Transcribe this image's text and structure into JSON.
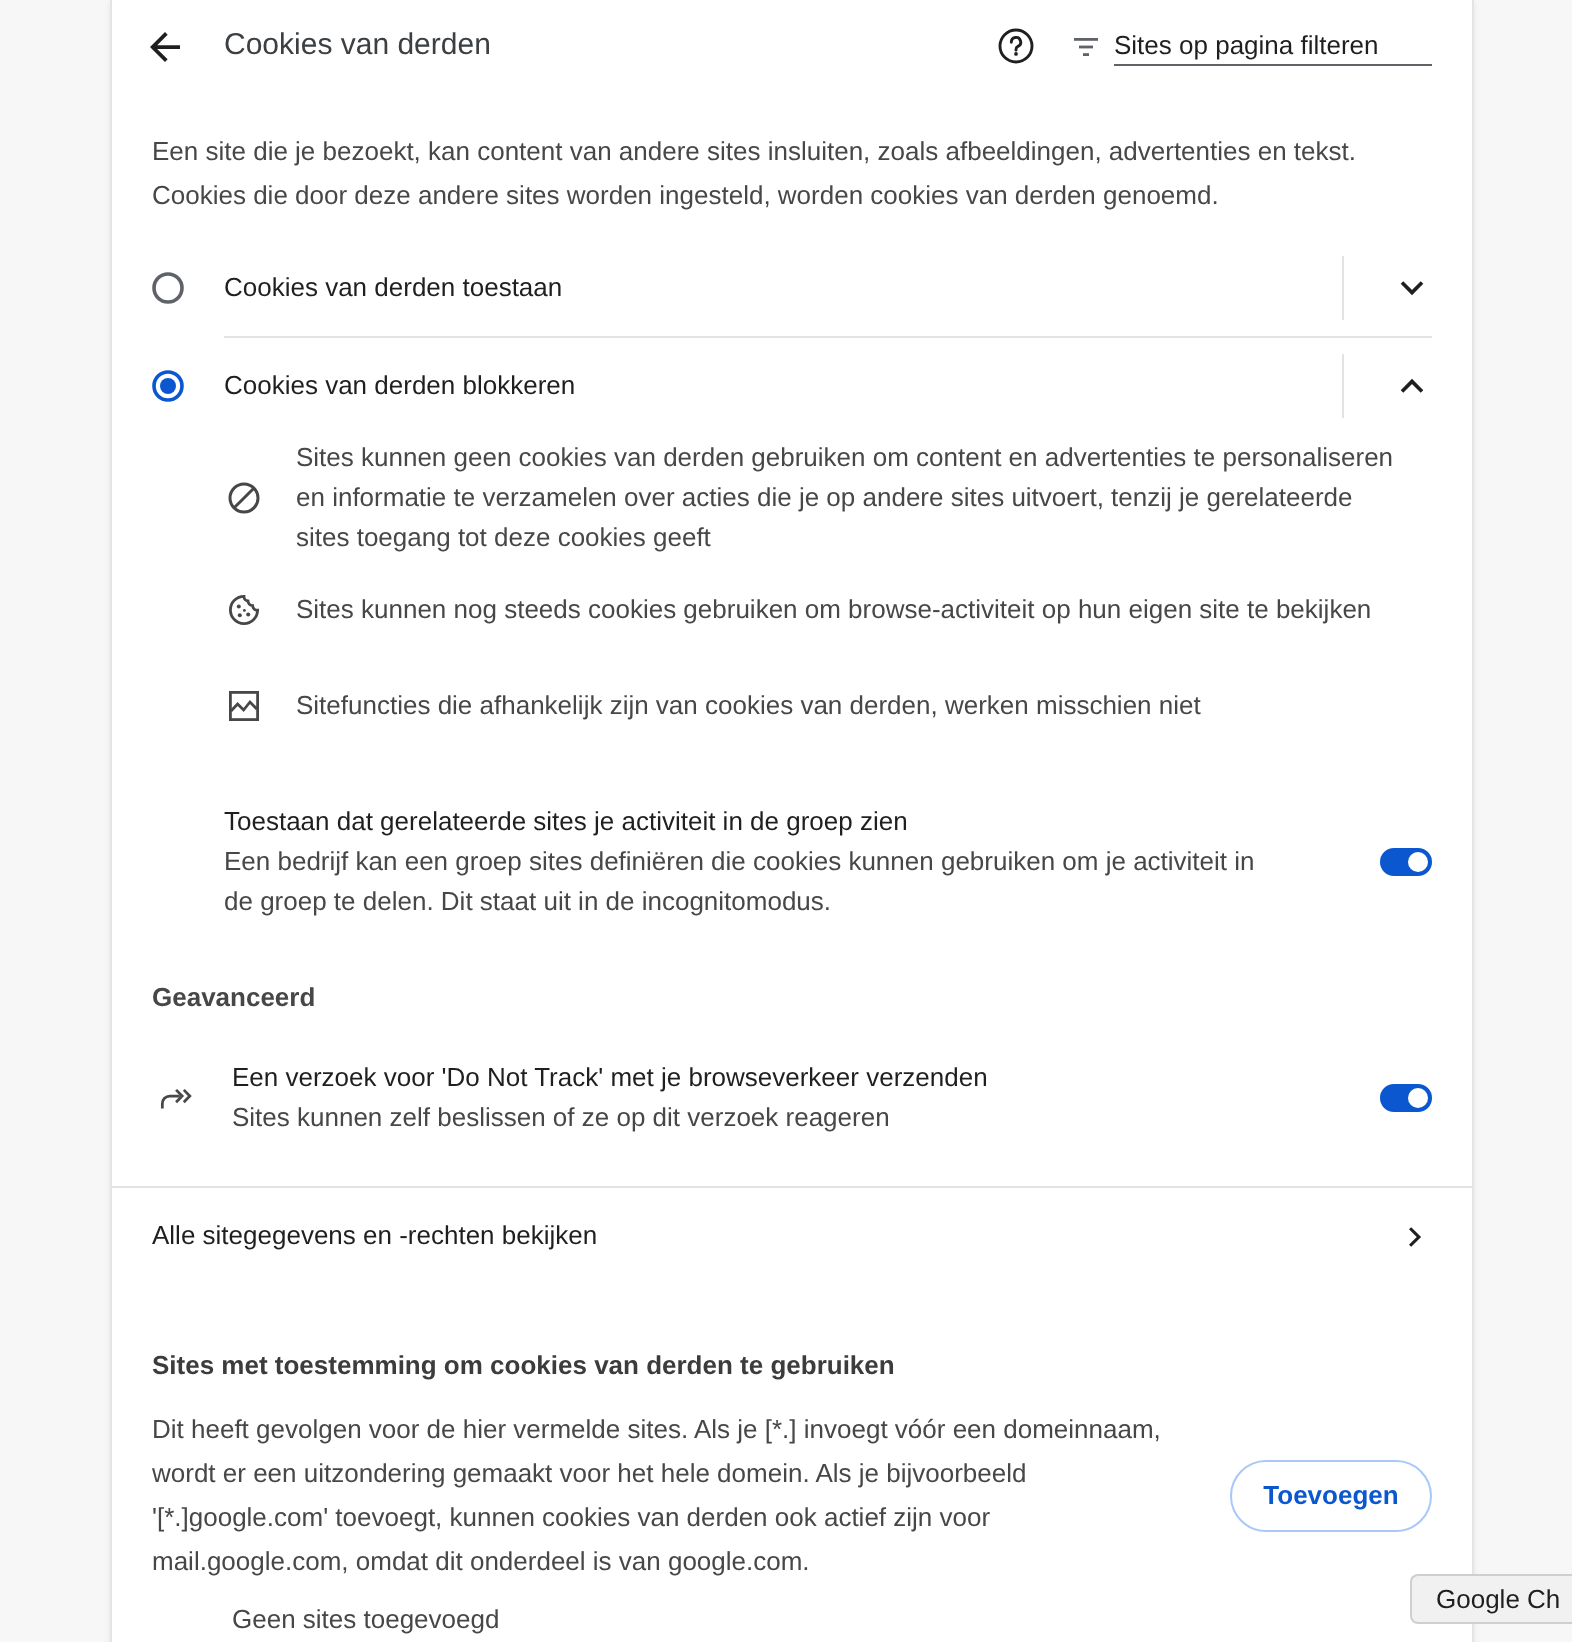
{
  "header": {
    "title": "Cookies van derden",
    "filter": {
      "placeholder": "Sites op pagina filteren"
    }
  },
  "intro": "Een site die je bezoekt, kan content van andere sites insluiten, zoals afbeeldingen, advertenties en tekst. Cookies die door deze andere sites worden ingesteld, worden cookies van derden genoemd.",
  "options": [
    {
      "label": "Cookies van derden toestaan",
      "selected": false,
      "expanded": false
    },
    {
      "label": "Cookies van derden blokkeren",
      "selected": true,
      "expanded": true,
      "details": [
        {
          "kind": "blocked",
          "text": "Sites kunnen geen cookies van derden gebruiken om content en advertenties te personaliseren en informatie te verzamelen over acties die je op andere sites uitvoert, tenzij je gerelateerde sites toegang tot deze cookies geeft"
        },
        {
          "kind": "cookie",
          "text": "Sites kunnen nog steeds cookies gebruiken om browse-activiteit op hun eigen site te bekijken"
        },
        {
          "kind": "image",
          "text": "Sitefuncties die afhankelijk zijn van cookies van derden, werken misschien niet"
        }
      ]
    }
  ],
  "related_sites": {
    "title": "Toestaan dat gerelateerde sites je activiteit in de groep zien",
    "description": "Een bedrijf kan een groep sites definiëren die cookies kunnen gebruiken om je activiteit in de groep te delen. Dit staat uit in de incognitomodus.",
    "on": true
  },
  "advanced": {
    "heading": "Geavanceerd",
    "items": [
      {
        "title": "Een verzoek voor 'Do Not Track' met je browseverkeer verzenden",
        "description": "Sites kunnen zelf beslissen of ze op dit verzoek reageren",
        "on": true
      }
    ]
  },
  "site_data_link": "Alle sitegegevens en -rechten bekijken",
  "allowed_sites": {
    "heading": "Sites met toestemming om cookies van derden te gebruiken",
    "description": "Dit heeft gevolgen voor de hier vermelde sites. Als je [*.] invoegt vóór een domeinnaam, wordt er een uitzondering gemaakt voor het hele domein. Als je bijvoorbeeld '[*.]google.com' toevoegt, kunnen cookies van derden ook actief zijn voor mail.google.com, omdat dit onderdeel is van google.com.",
    "add_button": "Toevoegen",
    "empty_text": "Geen sites toegevoegd"
  },
  "tooltip": "Google Ch"
}
